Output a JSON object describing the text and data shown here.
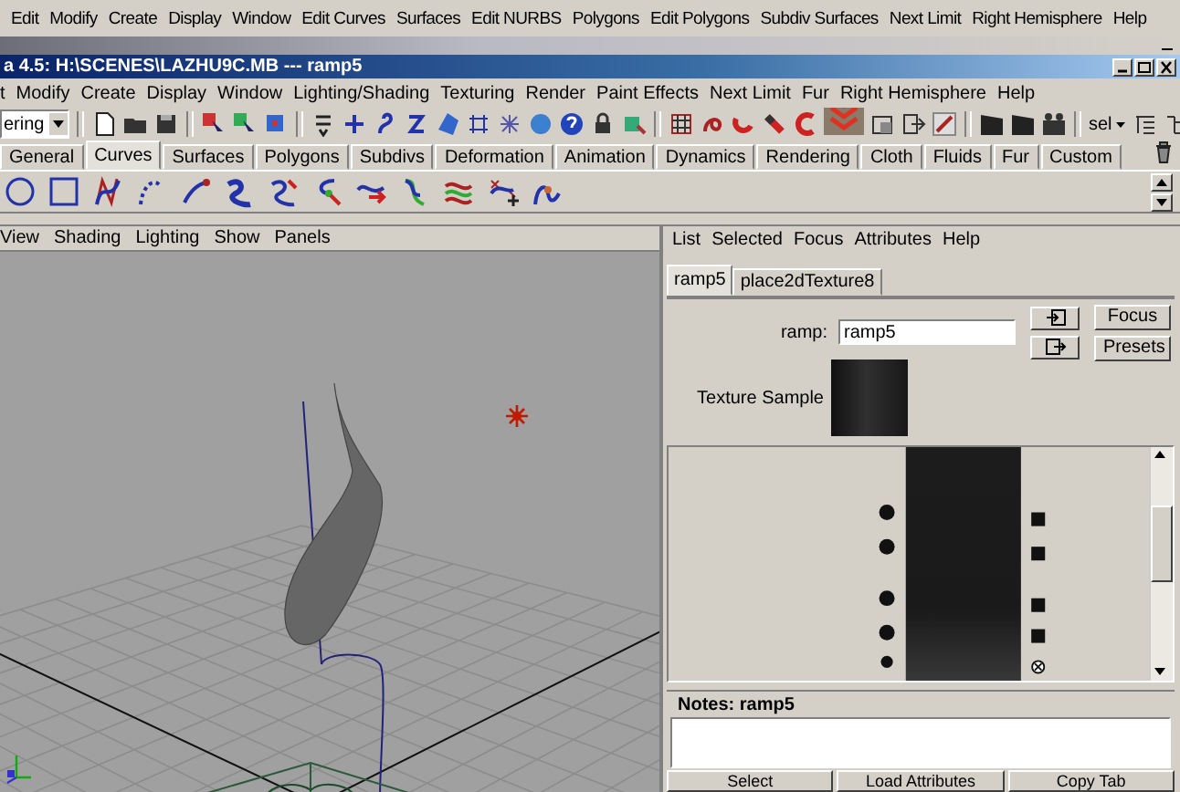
{
  "background_menu": [
    "Edit",
    "Modify",
    "Create",
    "Display",
    "Window",
    "Edit Curves",
    "Surfaces",
    "Edit NURBS",
    "Polygons",
    "Edit Polygons",
    "Subdiv Surfaces",
    "Next Limit",
    "Right Hemisphere",
    "Help"
  ],
  "window": {
    "title": "a 4.5: H:\\SCENES\\LAZHU9C.MB  ---  ramp5"
  },
  "menu": [
    "t",
    "Modify",
    "Create",
    "Display",
    "Window",
    "Lighting/Shading",
    "Texturing",
    "Render",
    "Paint Effects",
    "Next Limit",
    "Fur",
    "Right Hemisphere",
    "Help"
  ],
  "toolbar": {
    "mode_dropdown": "ering",
    "selection_label": "sel"
  },
  "shelf": {
    "tabs": [
      {
        "label": "General",
        "selected": false
      },
      {
        "label": "Curves",
        "selected": true
      },
      {
        "label": "Surfaces",
        "selected": false
      },
      {
        "label": "Polygons",
        "selected": false
      },
      {
        "label": "Subdivs",
        "selected": false
      },
      {
        "label": "Deformation",
        "selected": false
      },
      {
        "label": "Animation",
        "selected": false
      },
      {
        "label": "Dynamics",
        "selected": false
      },
      {
        "label": "Rendering",
        "selected": false
      },
      {
        "label": "Cloth",
        "selected": false
      },
      {
        "label": "Fluids",
        "selected": false
      },
      {
        "label": "Fur",
        "selected": false
      },
      {
        "label": "Custom",
        "selected": false
      }
    ]
  },
  "viewport": {
    "menu": [
      "View",
      "Shading",
      "Lighting",
      "Show",
      "Panels"
    ]
  },
  "attribute_editor": {
    "menu": [
      "List",
      "Selected",
      "Focus",
      "Attributes",
      "Help"
    ],
    "tabs": [
      {
        "label": "ramp5",
        "selected": true
      },
      {
        "label": "place2dTexture8",
        "selected": false
      }
    ],
    "name_label": "ramp:",
    "name_value": "ramp5",
    "side_buttons": [
      "Focus",
      "Presets"
    ],
    "texture_sample_label": "Texture Sample",
    "notes_title": "Notes: ramp5",
    "bottom_buttons": [
      "Select",
      "Load Attributes",
      "Copy Tab"
    ]
  }
}
